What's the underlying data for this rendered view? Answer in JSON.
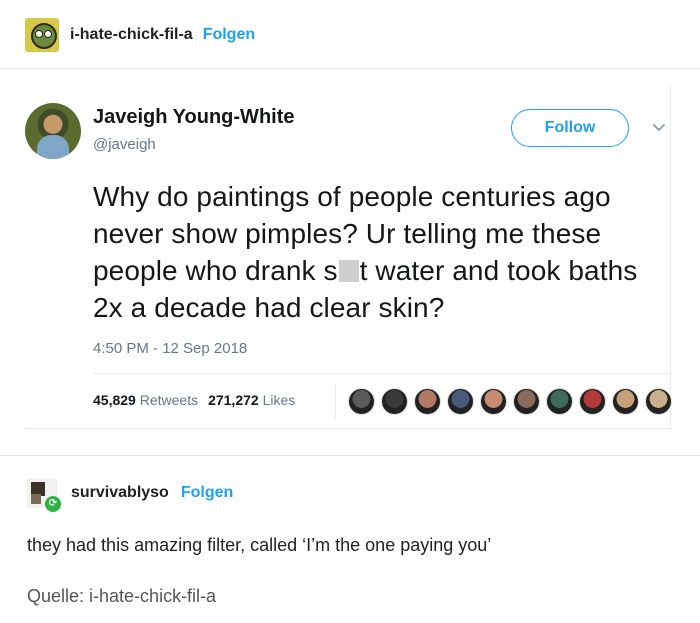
{
  "post": {
    "username": "i-hate-chick-fil-a",
    "follow_label": "Folgen"
  },
  "tweet": {
    "display_name": "Javeigh Young-White",
    "handle": "@javeigh",
    "follow_button": "Follow",
    "text_part1": "Why do paintings of people centuries ago never show pimples? Ur telling me these people who drank s",
    "text_part2": "t water and took baths 2x a decade had clear skin?",
    "timestamp": "4:50 PM - 12 Sep 2018",
    "retweets_count": "45,829",
    "retweets_label": "Retweets",
    "likes_count": "271,272",
    "likes_label": "Likes",
    "liker_colors": [
      "#5a5a5a",
      "#3a3a3a",
      "#b07a63",
      "#4a5a7a",
      "#c98a72",
      "#8a6a5a",
      "#3f6a5a",
      "#b23a3a",
      "#c7a07a",
      "#c9b08a"
    ]
  },
  "reblog": {
    "username": "survivablyso",
    "follow_label": "Folgen",
    "comment": "they had this amazing filter, called ‘I’m the one paying you’",
    "source": "Quelle: i-hate-chick-fil-a"
  },
  "colors": {
    "accent": "#1da1f2",
    "secondary_text": "#657786",
    "reblog_badge": "#2fb344"
  }
}
